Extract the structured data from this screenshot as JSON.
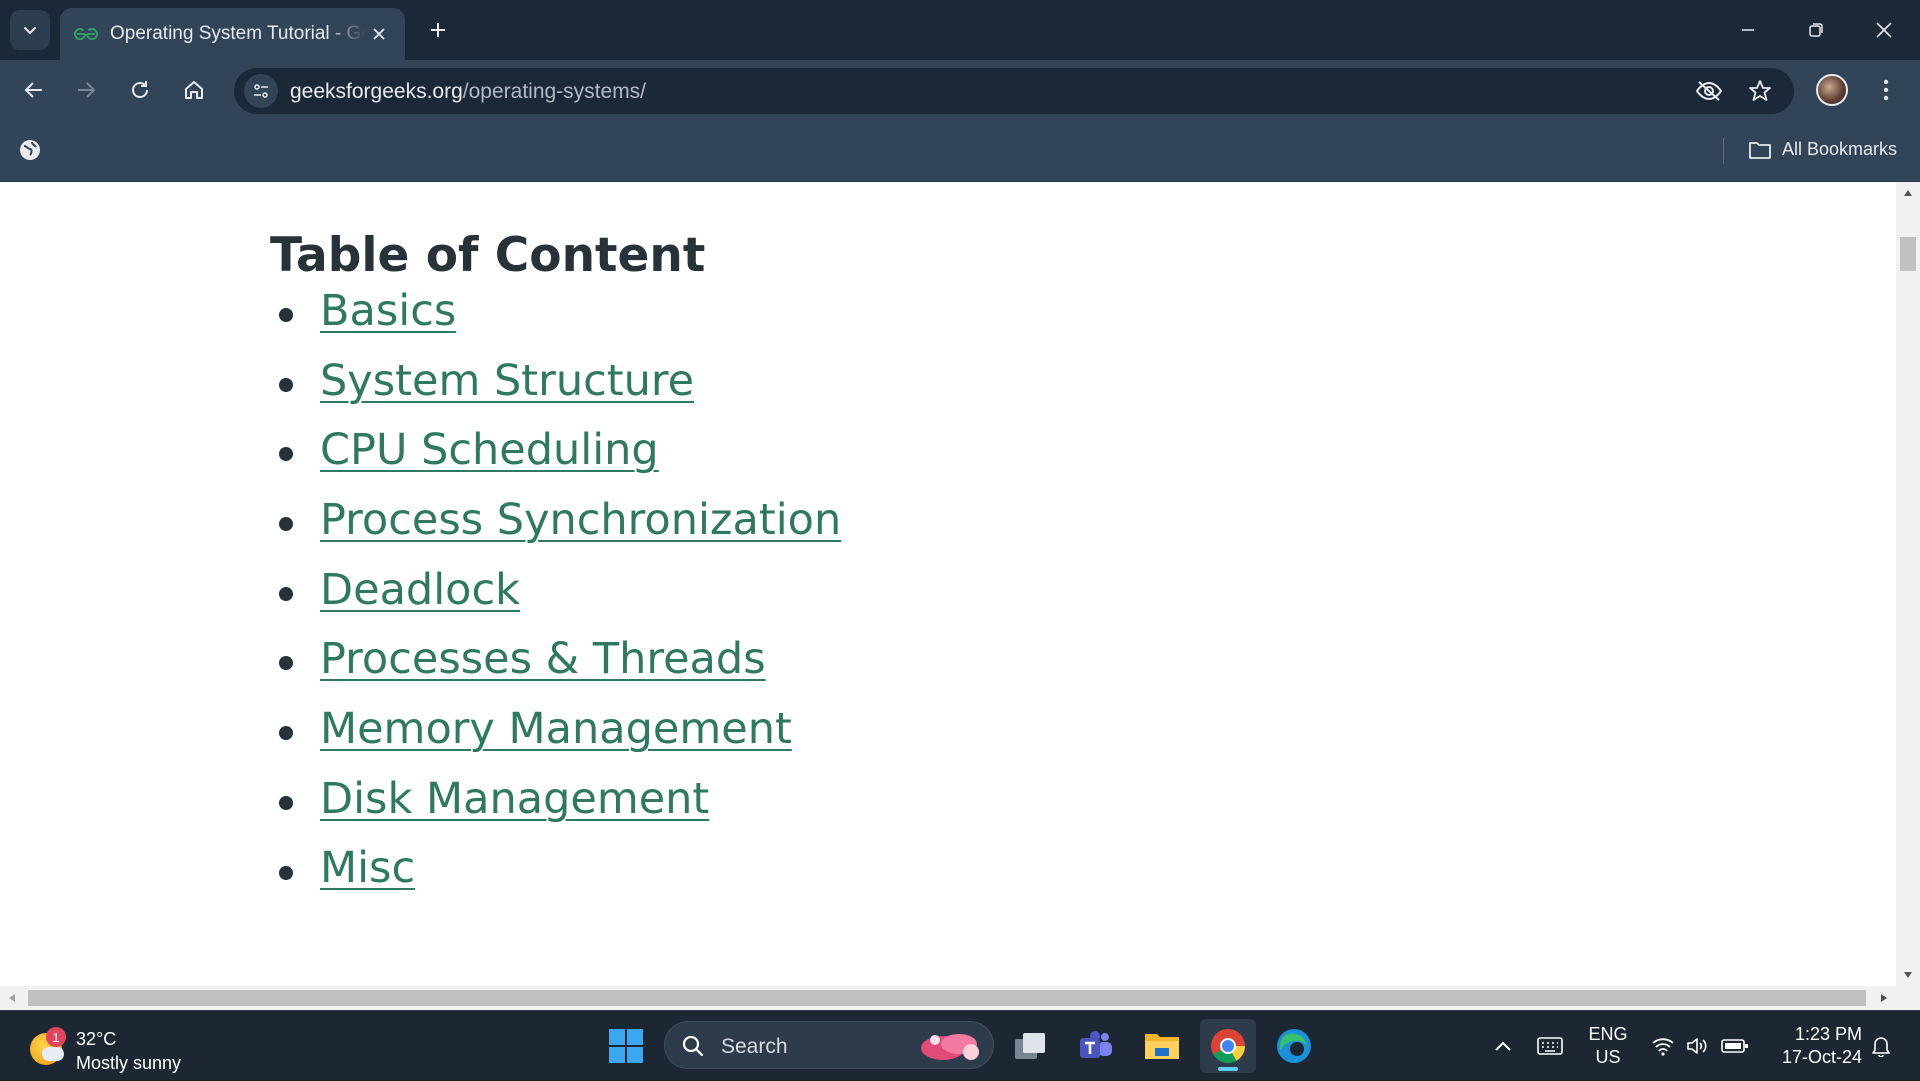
{
  "browser": {
    "tab_title": "Operating System Tutorial - GeeksforGeeks",
    "url_host": "geeksforgeeks.org",
    "url_path": "/operating-systems/",
    "all_bookmarks_label": "All Bookmarks"
  },
  "page": {
    "toc_title": "Table of Content",
    "toc_items": [
      "Basics",
      "System Structure",
      "CPU Scheduling",
      "Process Synchronization",
      "Deadlock",
      "Processes & Threads",
      "Memory Management",
      "Disk Management",
      "Misc"
    ],
    "link_color": "#2f7a5f",
    "heading_color": "#273239"
  },
  "taskbar": {
    "weather_temp": "32°C",
    "weather_condition": "Mostly sunny",
    "weather_badge": "1",
    "search_placeholder": "Search",
    "lang_line1": "ENG",
    "lang_line2": "US",
    "time": "1:23 PM",
    "date": "17-Oct-24"
  },
  "icons": {
    "tab_search": "chevron-down-icon",
    "favicon": "gfg-logo-icon",
    "back": "arrow-left-icon",
    "forward": "arrow-right-icon",
    "reload": "reload-icon",
    "home": "home-icon",
    "site_info": "tune-icon",
    "eye_off": "eye-off-icon",
    "star": "star-icon",
    "menu": "kebab-menu-icon"
  }
}
